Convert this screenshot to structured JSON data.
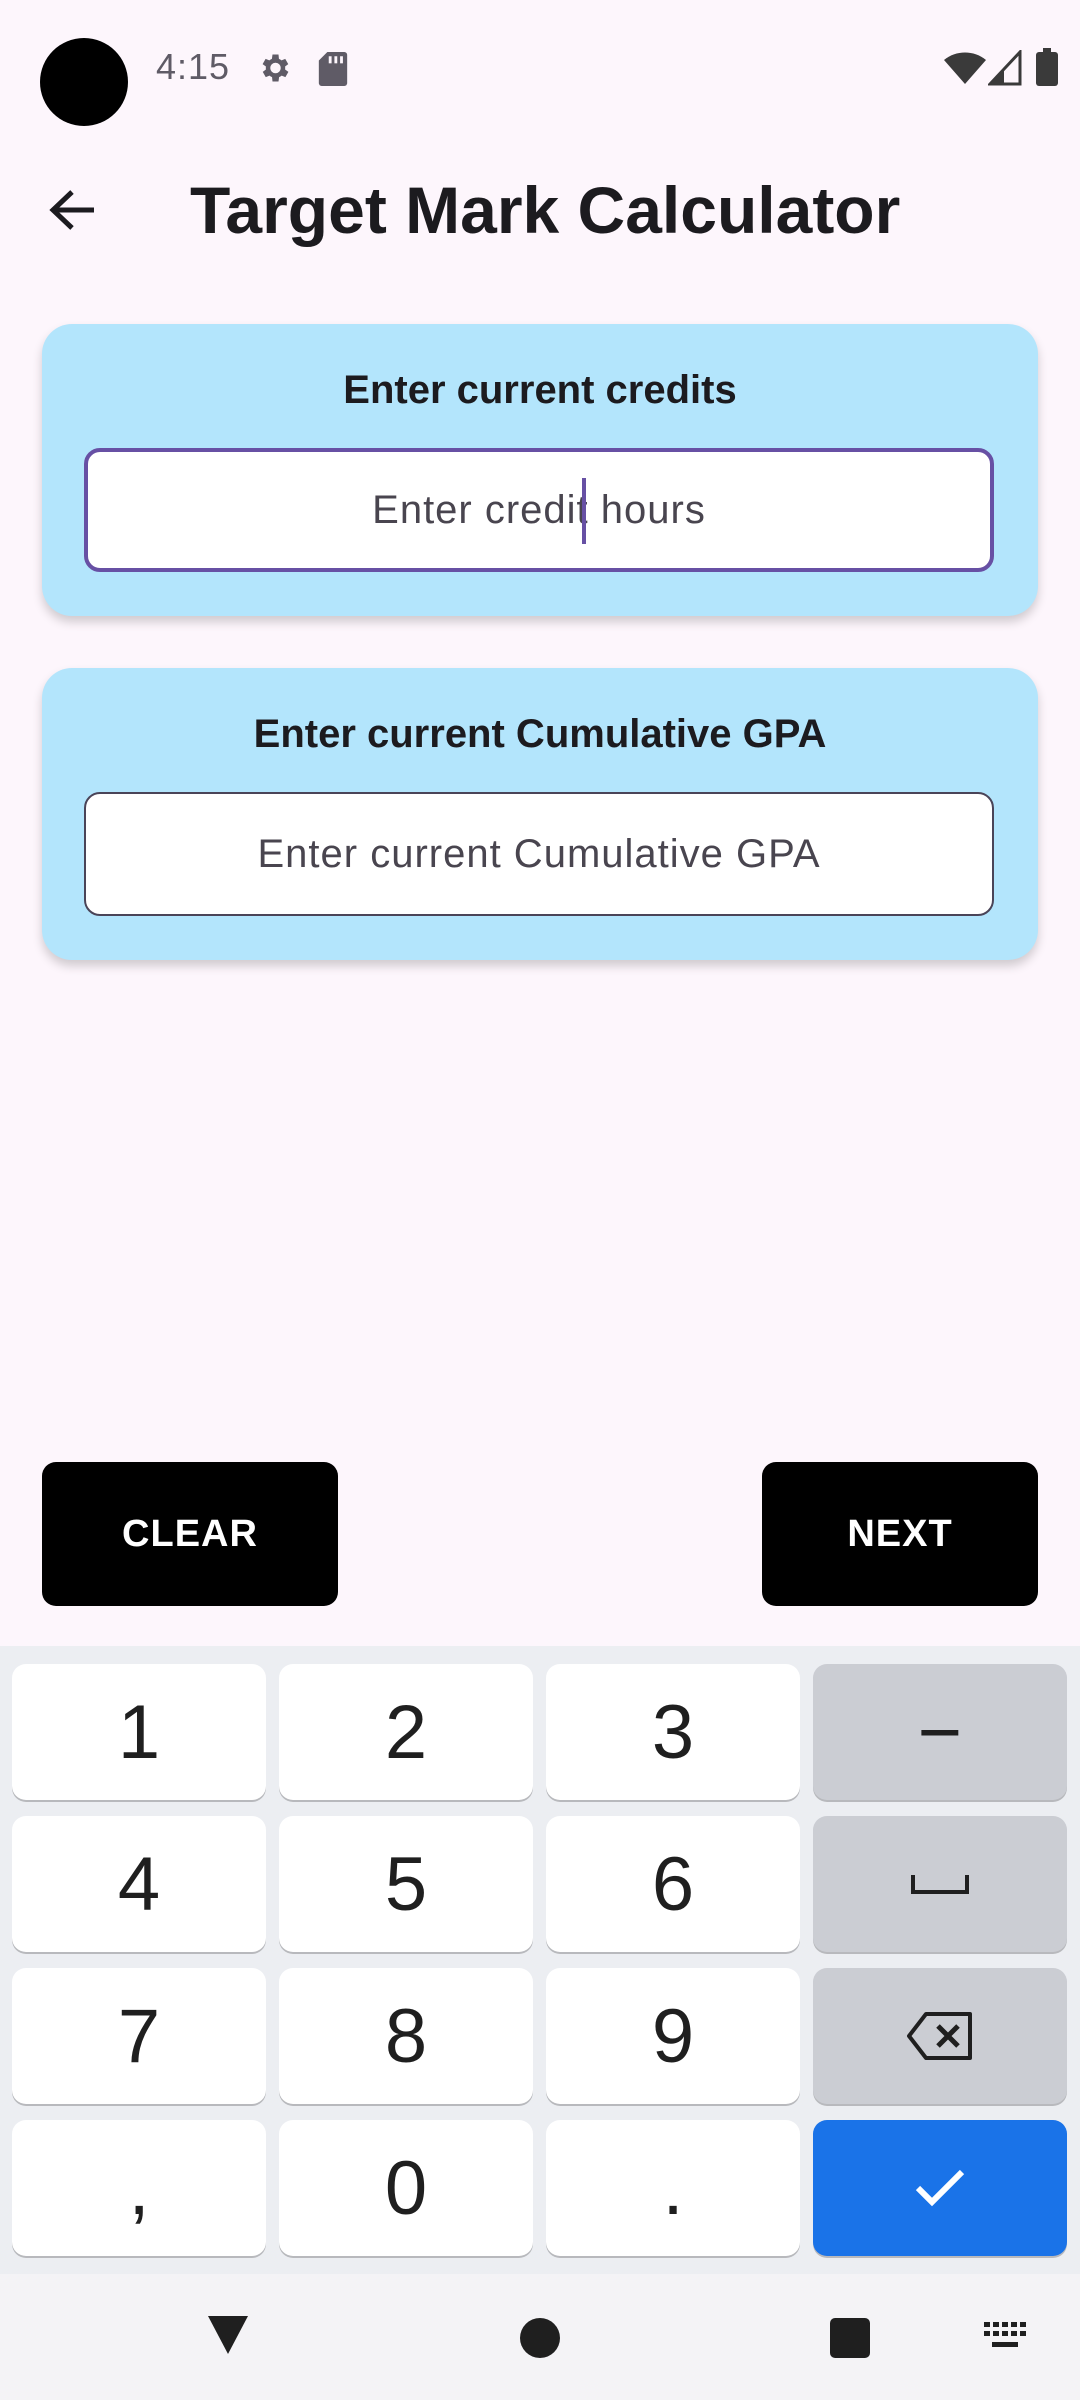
{
  "status_bar": {
    "time": "4:15",
    "icons": [
      "settings-icon",
      "sd-card-icon",
      "wifi-icon",
      "signal-icon",
      "battery-icon"
    ]
  },
  "app_bar": {
    "title": "Target Mark Calculator",
    "back_icon": "arrow-back-icon"
  },
  "cards": [
    {
      "label": "Enter current credits",
      "placeholder": "Enter credit hours",
      "value": ""
    },
    {
      "label": "Enter current Cumulative GPA",
      "placeholder": "Enter current Cumulative GPA",
      "value": ""
    }
  ],
  "actions": {
    "clear_label": "CLEAR",
    "next_label": "NEXT"
  },
  "keyboard": {
    "rows": [
      [
        "1",
        "2",
        "3",
        "−"
      ],
      [
        "4",
        "5",
        "6",
        "space-icon"
      ],
      [
        "7",
        "8",
        "9",
        "backspace-icon"
      ],
      [
        ",",
        "0",
        ".",
        "check-icon"
      ]
    ]
  },
  "nav_bar": {
    "icons": [
      "nav-back-icon",
      "nav-home-icon",
      "nav-recents-icon",
      "keyboard-switch-icon"
    ]
  },
  "colors": {
    "background": "#fdf6fc",
    "card": "#b3e5fc",
    "focus_border": "#6750a4",
    "button": "#000000",
    "done_key": "#1a73e8"
  }
}
